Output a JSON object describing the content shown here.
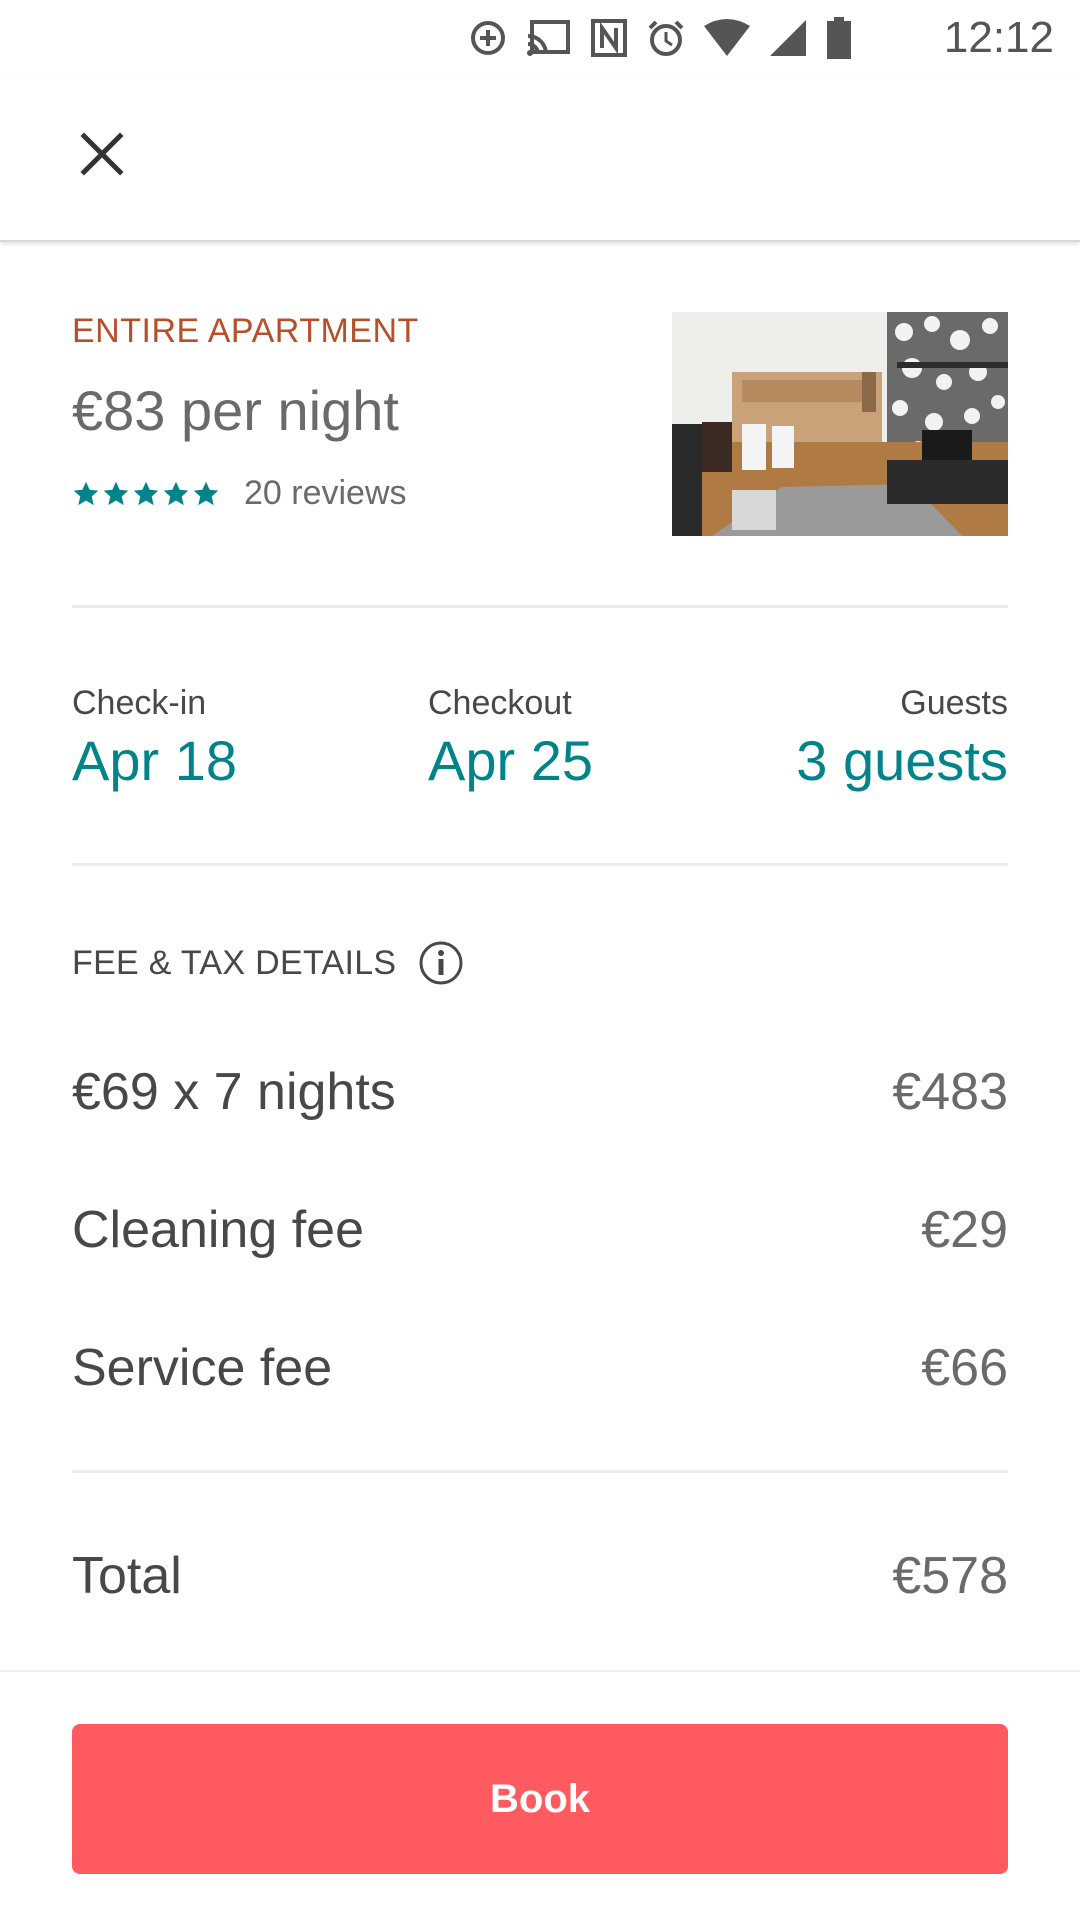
{
  "status_bar": {
    "time": "12:12",
    "icons": [
      "data-saver-icon",
      "cast-icon",
      "nfc-icon",
      "alarm-icon",
      "wifi-icon",
      "cell-signal-icon",
      "battery-icon"
    ]
  },
  "toolbar": {
    "close_icon": "close-icon"
  },
  "listing": {
    "type": "ENTIRE APARTMENT",
    "price": "€83 per night",
    "rating": 5,
    "rating_max": 5,
    "reviews": "20 reviews",
    "photo": "apartment-photo"
  },
  "trip": {
    "checkin_label": "Check-in",
    "checkin_value": "Apr 18",
    "checkout_label": "Checkout",
    "checkout_value": "Apr 25",
    "guests_label": "Guests",
    "guests_value": "3 guests"
  },
  "fees": {
    "header": "FEE & TAX DETAILS",
    "rows": [
      {
        "label": "€69 x 7 nights",
        "amount": "€483"
      },
      {
        "label": "Cleaning fee",
        "amount": "€29"
      },
      {
        "label": "Service fee",
        "amount": "€66"
      }
    ],
    "total_label": "Total",
    "total_amount": "€578"
  },
  "footer": {
    "book_label": "Book"
  },
  "colors": {
    "accent": "#008489",
    "brand": "#ff5a5f",
    "listing_type": "#b4502a",
    "text": "#484848"
  }
}
